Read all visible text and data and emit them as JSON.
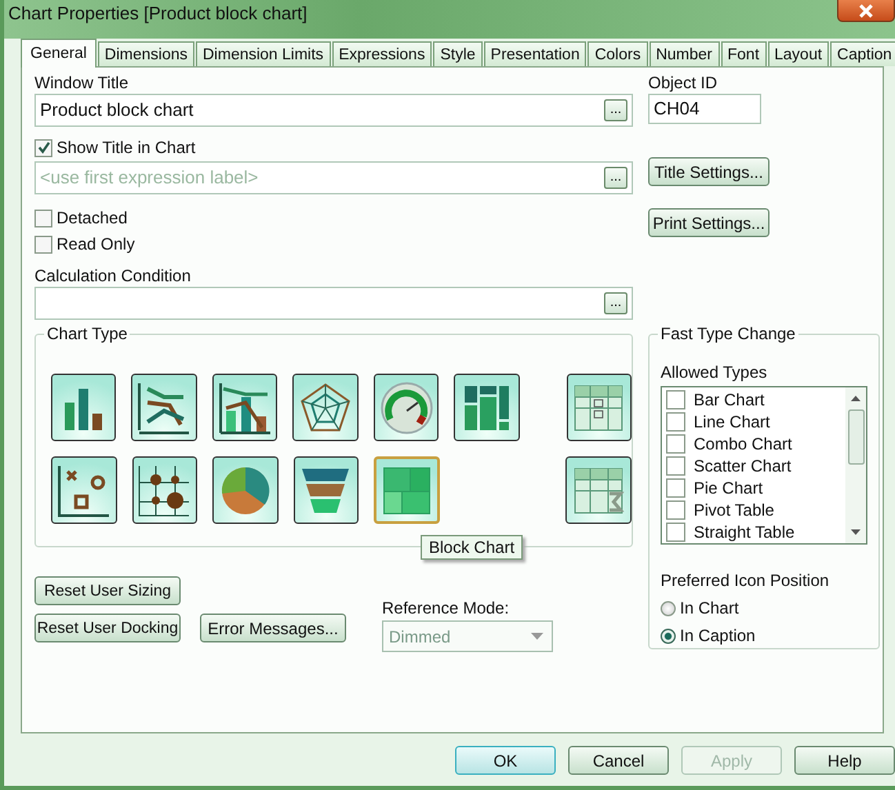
{
  "window": {
    "title": "Chart Properties [Product block chart]"
  },
  "tabs": [
    {
      "label": "General",
      "selected": true
    },
    {
      "label": "Dimensions",
      "selected": false
    },
    {
      "label": "Dimension Limits",
      "selected": false
    },
    {
      "label": "Expressions",
      "selected": false
    },
    {
      "label": "Style",
      "selected": false
    },
    {
      "label": "Presentation",
      "selected": false
    },
    {
      "label": "Colors",
      "selected": false
    },
    {
      "label": "Number",
      "selected": false
    },
    {
      "label": "Font",
      "selected": false
    },
    {
      "label": "Layout",
      "selected": false
    },
    {
      "label": "Caption",
      "selected": false
    }
  ],
  "window_title": {
    "label": "Window Title",
    "value": "Product block chart",
    "browse": "..."
  },
  "object_id": {
    "label": "Object ID",
    "value": "CH04"
  },
  "show_title": {
    "label": "Show Title in Chart",
    "checked": true
  },
  "title_field": {
    "placeholder": "<use first expression label>",
    "browse": "..."
  },
  "title_settings": "Title Settings...",
  "print_settings": "Print Settings...",
  "detached": {
    "label": "Detached",
    "checked": false
  },
  "read_only": {
    "label": "Read Only",
    "checked": false
  },
  "calculation_condition": {
    "label": "Calculation Condition",
    "browse": "..."
  },
  "chart_type": {
    "label": "Chart Type",
    "tooltip": "Block Chart",
    "items": [
      {
        "kind": "bar",
        "selected": false
      },
      {
        "kind": "line",
        "selected": false
      },
      {
        "kind": "combo",
        "selected": false
      },
      {
        "kind": "radar",
        "selected": false
      },
      {
        "kind": "gauge",
        "selected": false
      },
      {
        "kind": "mekko",
        "selected": false
      },
      {
        "kind": "pivot",
        "selected": false
      },
      {
        "kind": "scatter",
        "selected": false
      },
      {
        "kind": "grid",
        "selected": false
      },
      {
        "kind": "pie",
        "selected": false
      },
      {
        "kind": "funnel",
        "selected": false
      },
      {
        "kind": "block",
        "selected": true
      },
      {
        "kind": "straight",
        "selected": false
      }
    ]
  },
  "fast_type_change": {
    "label": "Fast Type Change",
    "allowed_label": "Allowed Types",
    "allowed_types": [
      {
        "label": "Bar Chart",
        "checked": false
      },
      {
        "label": "Line Chart",
        "checked": false
      },
      {
        "label": "Combo Chart",
        "checked": false
      },
      {
        "label": "Scatter Chart",
        "checked": false
      },
      {
        "label": "Pie Chart",
        "checked": false
      },
      {
        "label": "Pivot Table",
        "checked": false
      },
      {
        "label": "Straight Table",
        "checked": false
      }
    ],
    "position_label": "Preferred Icon Position",
    "positions": [
      {
        "label": "In Chart",
        "selected": false
      },
      {
        "label": "In Caption",
        "selected": true
      }
    ]
  },
  "reset_sizing": "Reset User Sizing",
  "reset_docking": "Reset User Docking",
  "error_messages": "Error Messages...",
  "reference_mode": {
    "label": "Reference Mode:",
    "value": "Dimmed",
    "disabled": true
  },
  "buttons": [
    {
      "label": "OK",
      "default": true,
      "disabled": false
    },
    {
      "label": "Cancel",
      "default": false,
      "disabled": false
    },
    {
      "label": "Apply",
      "default": false,
      "disabled": true
    },
    {
      "label": "Help",
      "default": false,
      "disabled": false
    }
  ]
}
